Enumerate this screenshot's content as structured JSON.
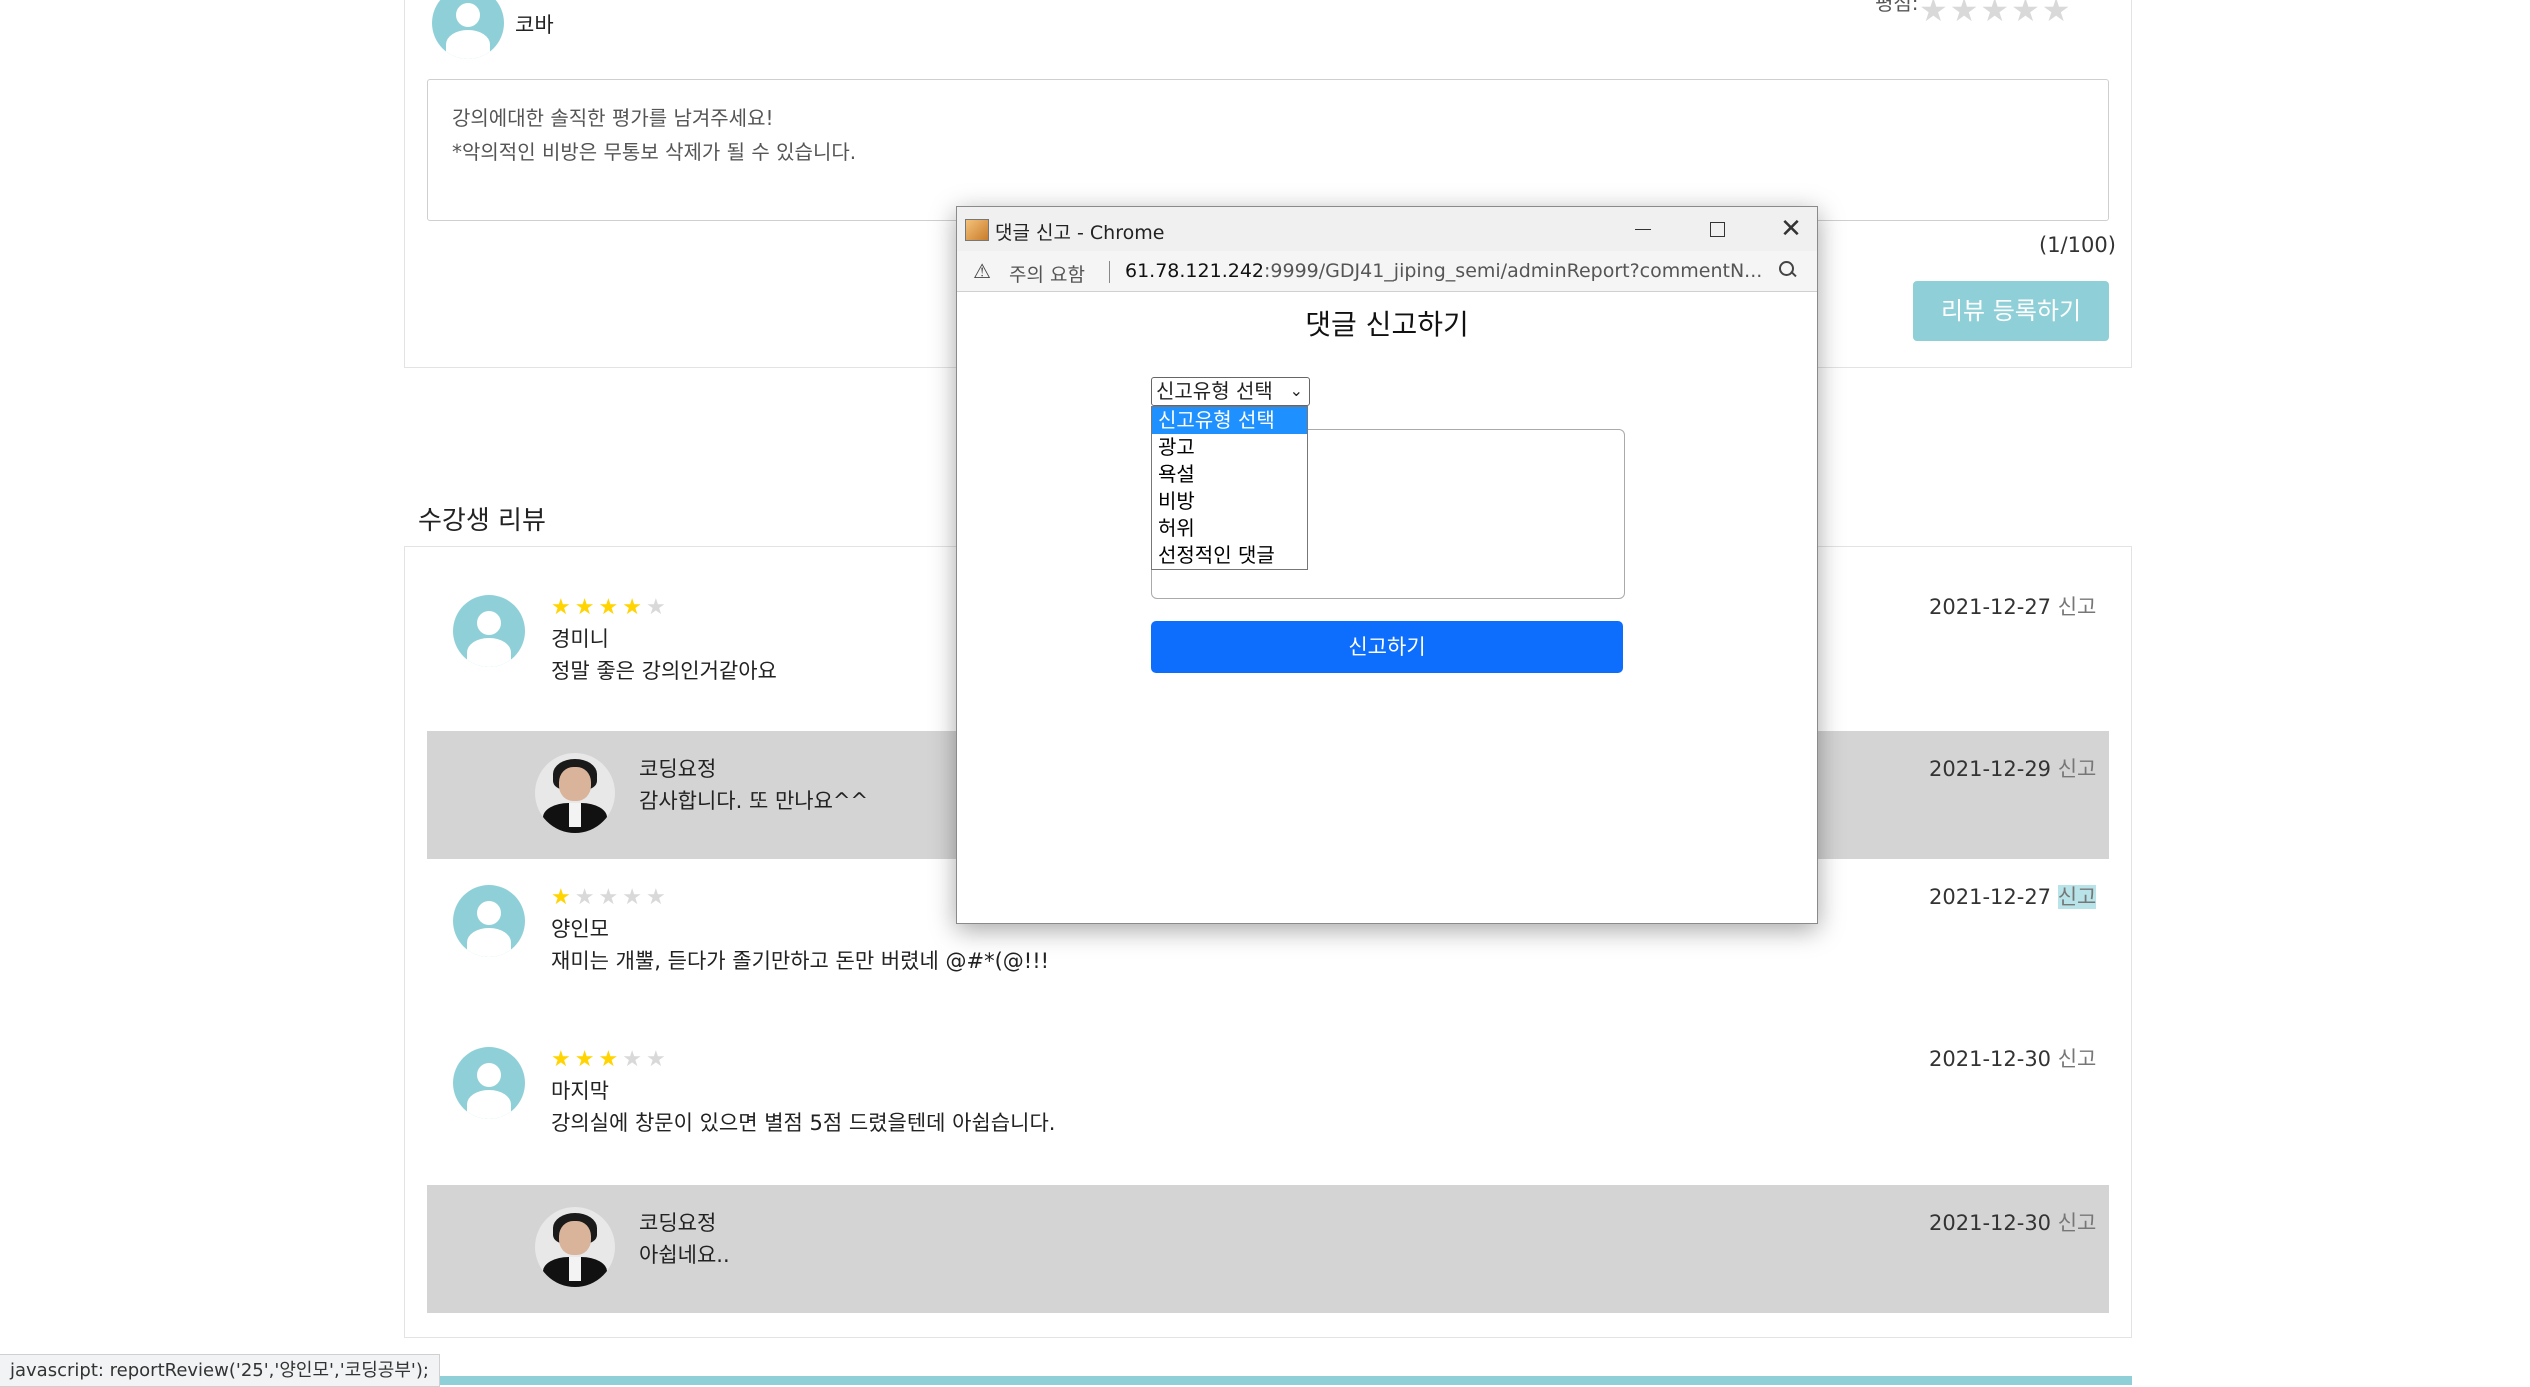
{
  "top_form": {
    "username": "코바",
    "rating_label": "평점:",
    "placeholder_line1": "강의에대한 솔직한 평가를 남겨주세요!",
    "placeholder_line2": "*악의적인 비방은 무통보 삭제가 될 수 있습니다.",
    "char_count": "(1/100)",
    "submit_label": "리뷰 등록하기"
  },
  "reviews_section": {
    "title": "수강생 리뷰",
    "report_label": "신고",
    "items": [
      {
        "type": "review",
        "stars": 4,
        "name": "경미니",
        "text": "정말 좋은 강의인거같아요",
        "date": "2021-12-27"
      },
      {
        "type": "reply",
        "name": "코딩요정",
        "text": "감사합니다. 또 만나요^^",
        "date": "2021-12-29"
      },
      {
        "type": "review",
        "stars": 1,
        "name": "양인모",
        "text": "재미는 개뿔, 듣다가 졸기만하고 돈만 버렸네 @#*(@!!!",
        "date": "2021-12-27"
      },
      {
        "type": "review",
        "stars": 3,
        "name": "마지막",
        "text": "강의실에 창문이 있으면 별점 5점 드렸을텐데 아쉽습니다.",
        "date": "2021-12-30"
      },
      {
        "type": "reply",
        "name": "코딩요정",
        "text": "아쉽네요..",
        "date": "2021-12-30"
      }
    ]
  },
  "status_bar": {
    "text": "javascript: reportReview('25','양인모','코딩공부');"
  },
  "popup": {
    "window_title": "댓글 신고 - Chrome",
    "security_label": "주의 요함",
    "url_host": "61.78.121.242",
    "url_rest": ":9999/GDJ41_jiping_semi/adminReport?commentN...",
    "heading": "댓글 신고하기",
    "select_value": "신고유형 선택",
    "options": [
      "신고유형 선택",
      "광고",
      "욕설",
      "비방",
      "허위",
      "선정적인 댓글"
    ],
    "submit_label": "신고하기"
  },
  "colors": {
    "accent": "#8fd0d8",
    "primary_button": "#0d6efd",
    "star_on": "#ffd400",
    "star_off": "#d9d9d9",
    "reply_bg": "#d4d4d4"
  }
}
